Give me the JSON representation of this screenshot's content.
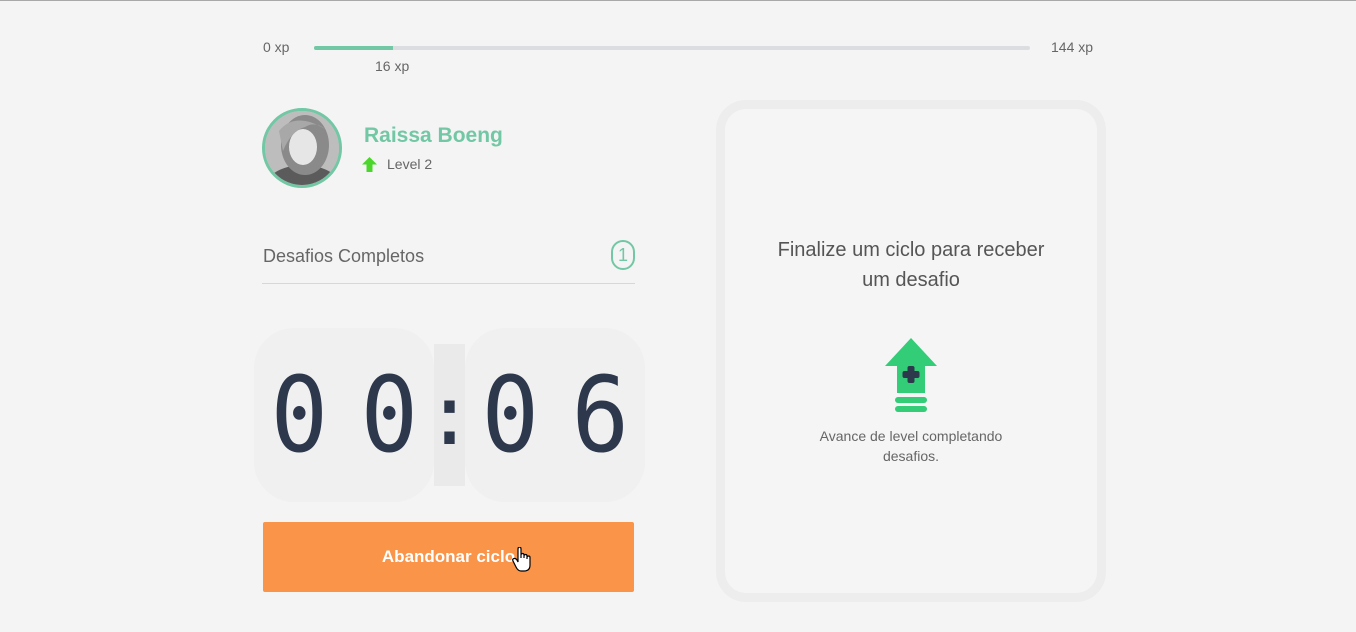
{
  "xp": {
    "min_label": "0 xp",
    "max_label": "144 xp",
    "current_label": "16 xp",
    "progress_fraction": 0.11
  },
  "profile": {
    "name": "Raissa Boeng",
    "level_label": "Level 2"
  },
  "challenges": {
    "label": "Desafios Completos",
    "count": "1"
  },
  "countdown": {
    "minute_tens": "0",
    "minute_ones": "0",
    "separator": ":",
    "second_tens": "0",
    "second_ones": "6"
  },
  "actions": {
    "abandon_label": "Abandonar ciclo"
  },
  "challenge_box": {
    "title_line1": "Finalize um ciclo para receber",
    "title_line2": "um desafio",
    "desc_line1": "Avance de level completando",
    "desc_line2": "desafios."
  },
  "colors": {
    "accent": "#72c7a4",
    "button": "#fa9448",
    "digits": "#2e384d",
    "level_up_icon": "#33cc77"
  }
}
